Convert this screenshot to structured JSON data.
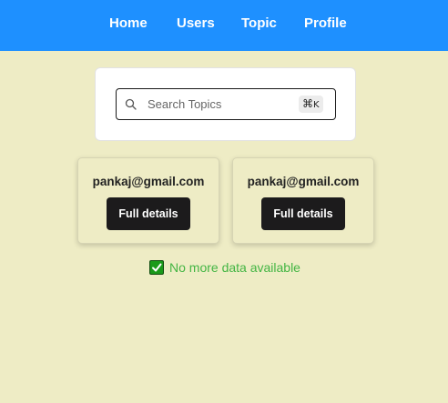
{
  "nav": {
    "items": [
      {
        "label": "Home"
      },
      {
        "label": "Users"
      },
      {
        "label": "Topic"
      },
      {
        "label": "Profile"
      }
    ],
    "background": "#1e90ff"
  },
  "search": {
    "placeholder": "Search Topics",
    "value": "",
    "shortcut_symbol": "⌘",
    "shortcut_key": "K",
    "icon": "search-icon"
  },
  "users": [
    {
      "email": "pankaj@gmail.com",
      "button_label": "Full details"
    },
    {
      "email": "pankaj@gmail.com",
      "button_label": "Full details"
    }
  ],
  "status": {
    "icon": "check-mark-icon",
    "text": "No more data available",
    "color": "#43b543"
  },
  "colors": {
    "page_background": "#eeecc5",
    "button_background": "#1c1b1c"
  }
}
